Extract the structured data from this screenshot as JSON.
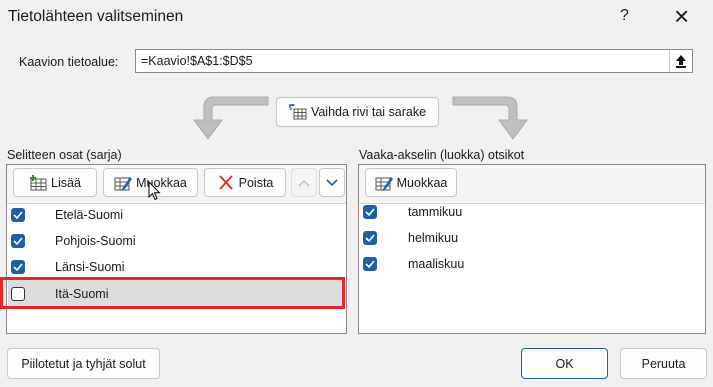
{
  "dialog": {
    "title": "Tietolähteen valitseminen",
    "help_glyph": "?",
    "close_glyph": "×"
  },
  "range": {
    "label": "Kaavion tietoalue:",
    "value": "=Kaavio!$A$1:$D$5"
  },
  "switch_label": "Vaihda rivi tai sarake",
  "legend": {
    "header": "Selitteen osat (sarja)",
    "add_label": "Lisää",
    "edit_label": "Muokkaa",
    "remove_label": "Poista",
    "items": [
      {
        "label": "Etelä-Suomi",
        "checked": true
      },
      {
        "label": "Pohjois-Suomi",
        "checked": true
      },
      {
        "label": "Länsi-Suomi",
        "checked": true
      },
      {
        "label": "Itä-Suomi",
        "checked": false
      }
    ]
  },
  "axis": {
    "header": "Vaaka-akselin (luokka) otsikot",
    "edit_label": "Muokkaa",
    "items": [
      {
        "label": "tammikuu",
        "checked": true
      },
      {
        "label": "helmikuu",
        "checked": true
      },
      {
        "label": "maaliskuu",
        "checked": true
      }
    ]
  },
  "footer": {
    "hidden_label": "Piilotetut ja tyhjät solut",
    "ok_label": "OK",
    "cancel_label": "Peruuta"
  },
  "colors": {
    "accent": "#1f5fa8",
    "highlight": "#e8262b",
    "selected_row": "#dcdcdc"
  }
}
